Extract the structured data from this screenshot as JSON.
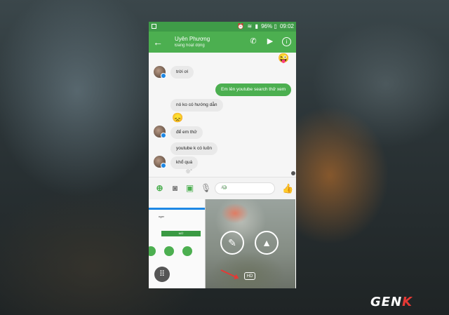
{
  "status_bar": {
    "battery": "96%",
    "time": "09:02"
  },
  "contact": {
    "name": "Uyên Phương",
    "status": "Đang hoạt động"
  },
  "messages": [
    {
      "dir": "in",
      "text": "trời ơi"
    },
    {
      "dir": "out",
      "text": "Em lên youtube search thử xem"
    },
    {
      "dir": "in",
      "text": "nó ko có hướng dẫn"
    },
    {
      "dir": "in",
      "text": "để em thử"
    },
    {
      "dir": "in",
      "text": "youtube k có luôn"
    },
    {
      "dir": "in",
      "text": "khổ quá"
    }
  ],
  "composer": {
    "placeholder": "Aa"
  },
  "tray": {
    "hd_label": "HD",
    "thumb_button": "MỞ",
    "thumb_title": "nger"
  },
  "watermark": {
    "brand_a": "GEN",
    "brand_b": "K"
  }
}
